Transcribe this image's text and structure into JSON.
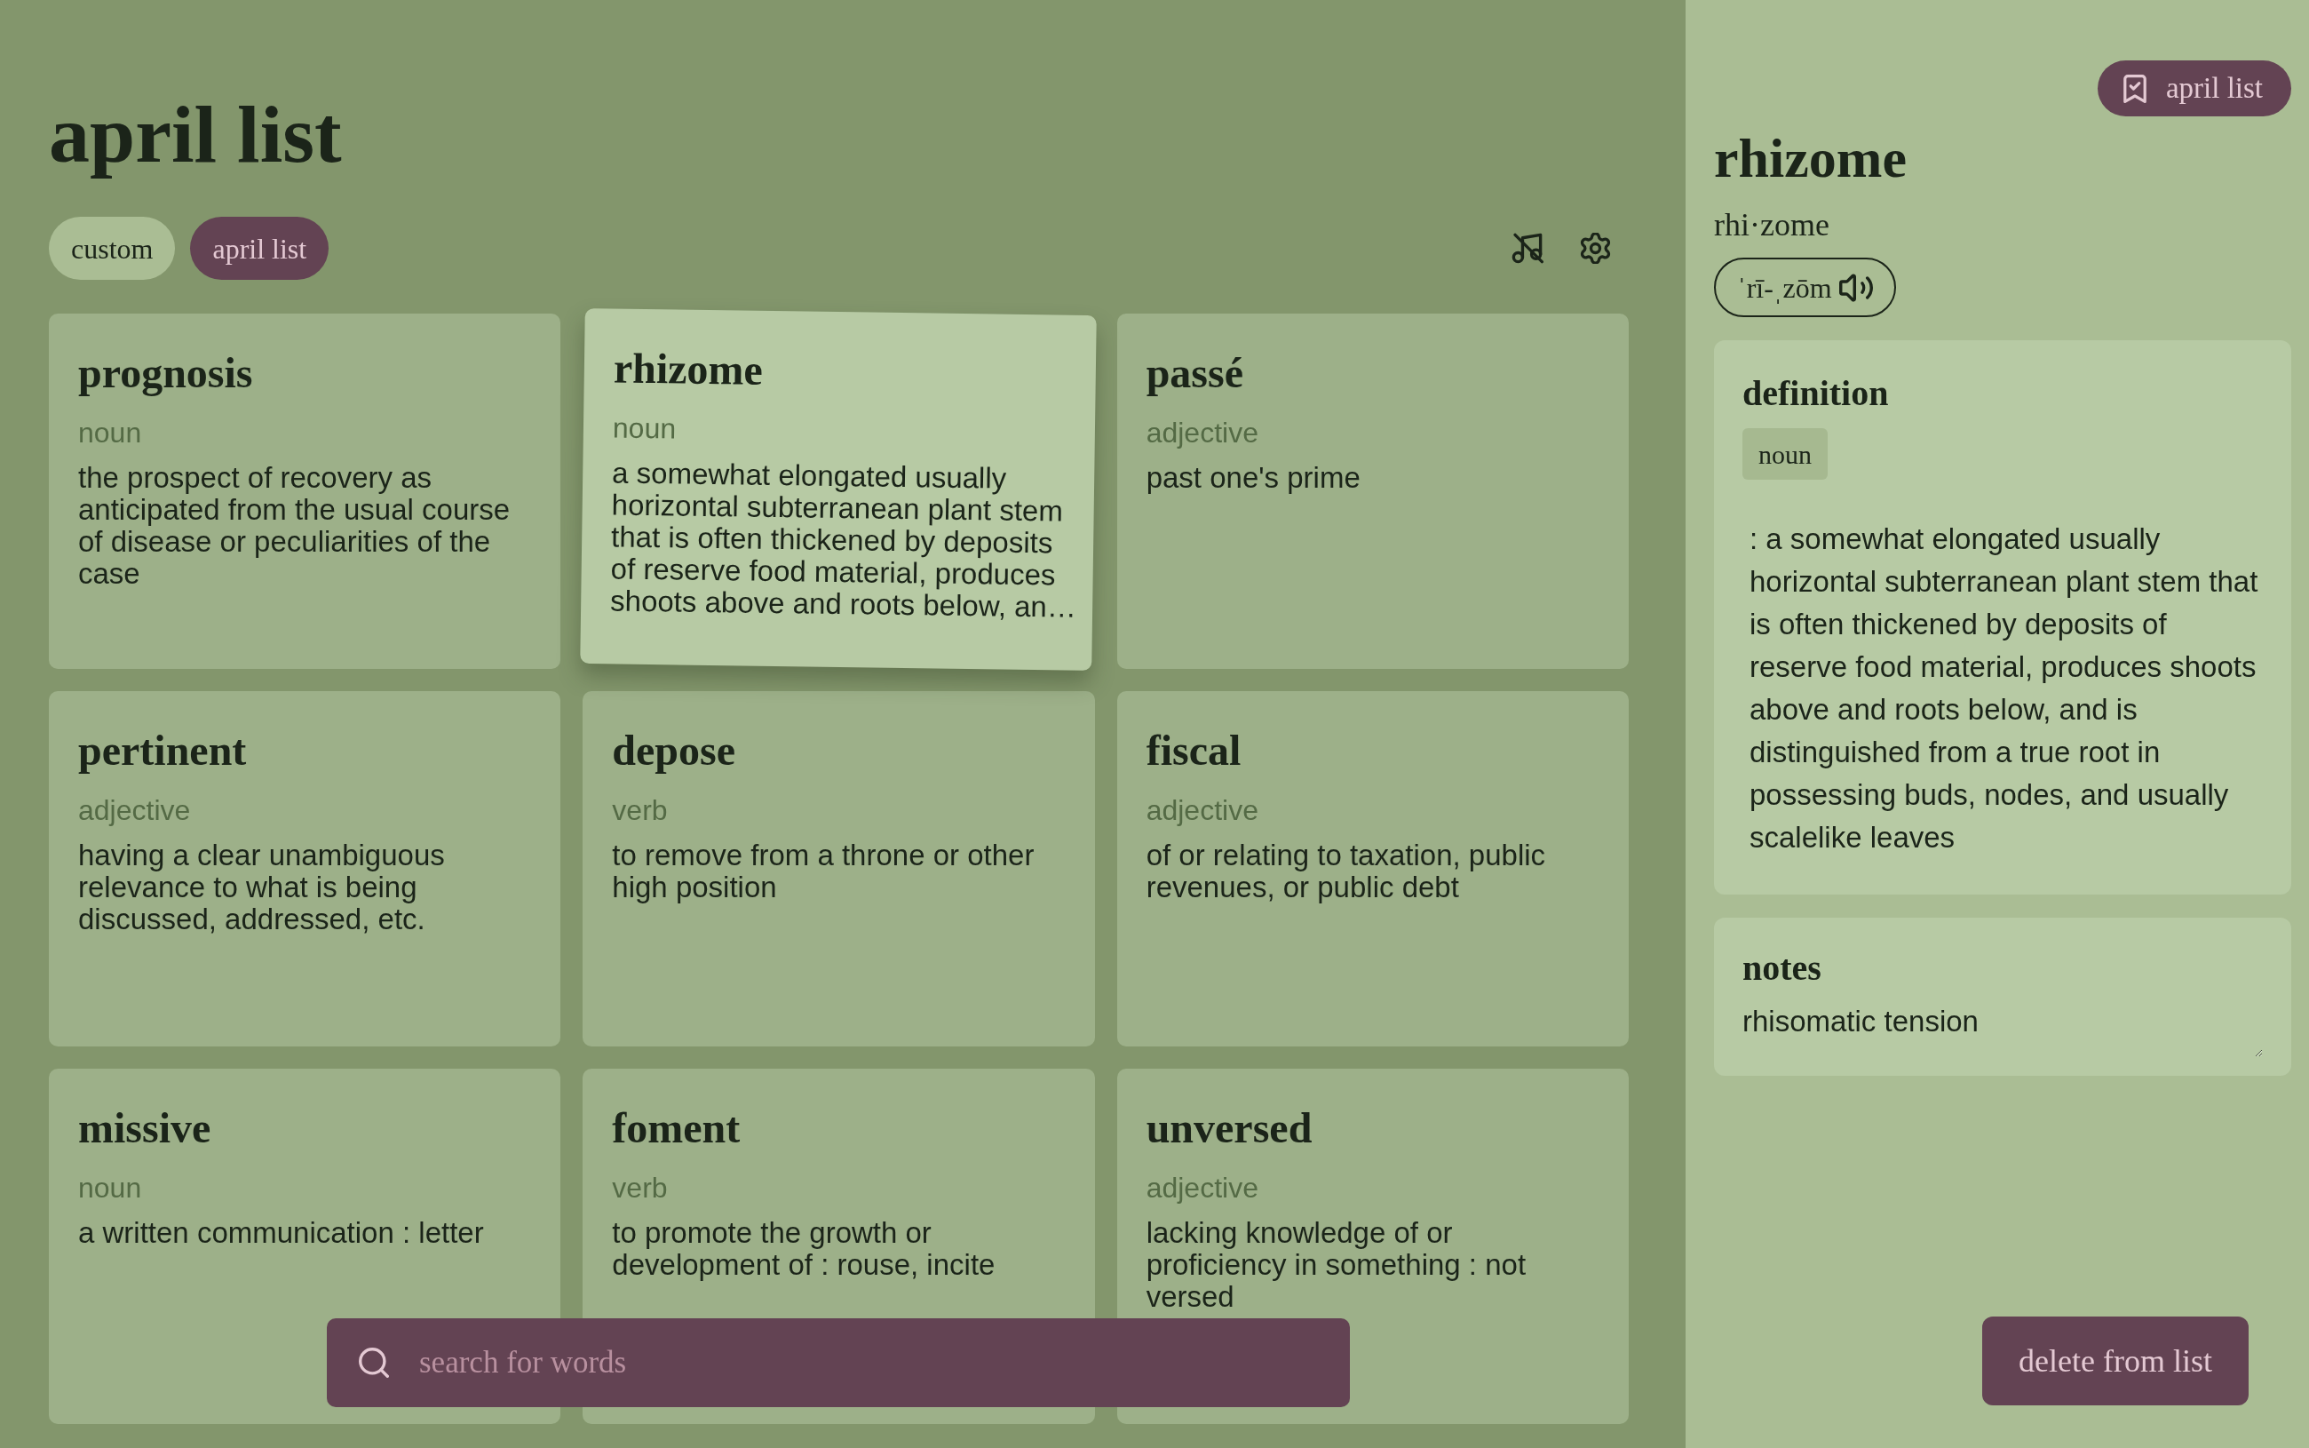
{
  "header": {
    "title": "april list"
  },
  "list_tabs": [
    {
      "label": "custom",
      "selected": false
    },
    {
      "label": "april list",
      "selected": true
    }
  ],
  "words": [
    {
      "word": "prognosis",
      "part_of_speech": "noun",
      "definition": "the prospect of recovery as anticipated from the usual course of disease or peculiarities of the case",
      "selected": false
    },
    {
      "word": "rhizome",
      "part_of_speech": "noun",
      "definition": "a somewhat elongated usually horizontal subterranean plant stem that is often thickened by deposits of reserve food material, produces shoots above and roots below, an…",
      "selected": true
    },
    {
      "word": "passé",
      "part_of_speech": "adjective",
      "definition": "past one's prime",
      "selected": false
    },
    {
      "word": "pertinent",
      "part_of_speech": "adjective",
      "definition": "having a clear unambiguous relevance to what is being discussed, addressed, etc.",
      "selected": false
    },
    {
      "word": "depose",
      "part_of_speech": "verb",
      "definition": "to remove from a throne or other high position",
      "selected": false
    },
    {
      "word": "fiscal",
      "part_of_speech": "adjective",
      "definition": "of or relating to taxation, public revenues, or public debt",
      "selected": false
    },
    {
      "word": "missive",
      "part_of_speech": "noun",
      "definition": "a written communication : letter",
      "selected": false
    },
    {
      "word": "foment",
      "part_of_speech": "verb",
      "definition": "to promote the growth or development of : rouse, incite",
      "selected": false
    },
    {
      "word": "unversed",
      "part_of_speech": "adjective",
      "definition": "lacking knowledge of or proficiency in something : not versed",
      "selected": false
    }
  ],
  "search": {
    "placeholder": "search for words"
  },
  "detail": {
    "list_button": {
      "label": "april list"
    },
    "word": "rhizome",
    "syllables": "rhi·zome",
    "pronunciation": "ˈrī-ˌzōm",
    "definition": {
      "heading": "definition",
      "part_of_speech": "noun",
      "text": ": a somewhat elongated usually horizontal subterranean plant stem that is often thickened by deposits of reserve food material, produces shoots above and roots below, and is distinguished from a true root in possessing buds, nodes, and usually scalelike leaves"
    },
    "notes": {
      "heading": "notes",
      "value": "rhisomatic tension"
    },
    "delete_button": {
      "label": "delete from list"
    }
  }
}
